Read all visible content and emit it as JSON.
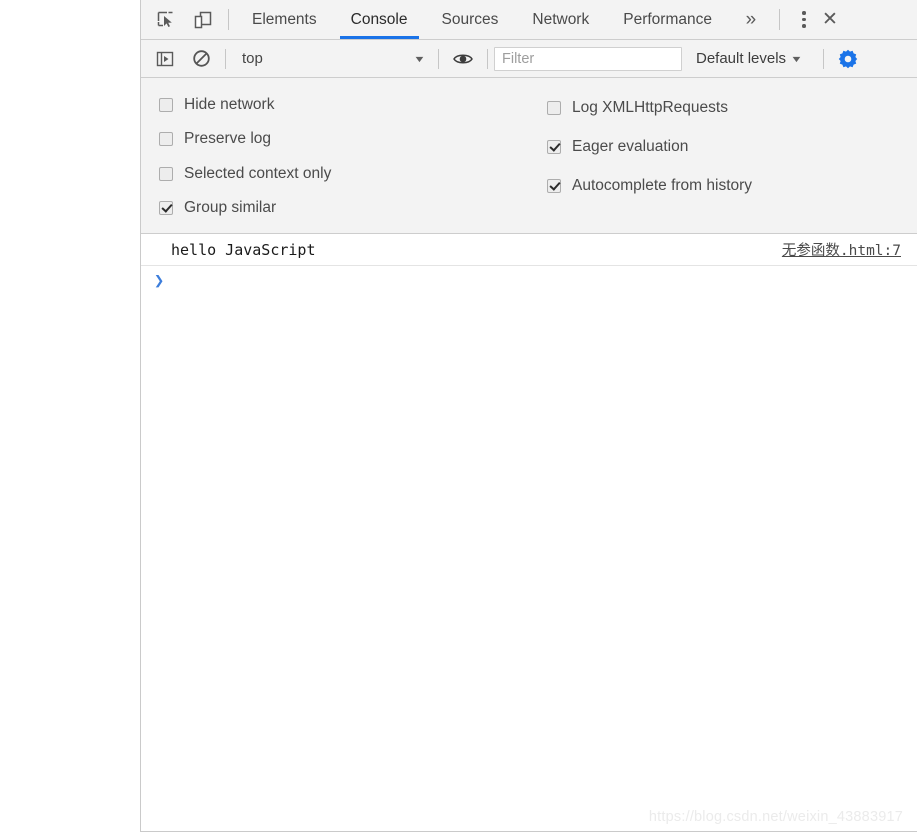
{
  "window": {
    "panel_name": "Chrome DevTools"
  },
  "tabbar": {
    "inspect_icon": "inspect-cursor-icon",
    "device_icon": "device-toolbar-icon",
    "tabs": [
      {
        "label": "Elements",
        "active": false
      },
      {
        "label": "Console",
        "active": true
      },
      {
        "label": "Sources",
        "active": false
      },
      {
        "label": "Network",
        "active": false
      },
      {
        "label": "Performance",
        "active": false
      }
    ],
    "overflow_label": "»",
    "more_options_icon": "kebab-menu-icon",
    "close_label": "✕",
    "active_tab_underline_color": "#1a73e8"
  },
  "filterbar": {
    "sidebar_toggle_icon": "console-sidebar-icon",
    "clear_console_icon": "clear-console-icon",
    "context": {
      "value": "top",
      "caret": "▼"
    },
    "eye_icon": "live-expression-eye-icon",
    "filter": {
      "value": "",
      "placeholder": "Filter"
    },
    "levels": {
      "label": "Default levels",
      "caret": "▼"
    },
    "settings_gear_icon": "settings-gear-icon",
    "settings_gear_color": "#1a73e8"
  },
  "settings": {
    "left_column": [
      {
        "label": "Hide network",
        "checked": false
      },
      {
        "label": "Preserve log",
        "checked": false
      },
      {
        "label": "Selected context only",
        "checked": false
      },
      {
        "label": "Group similar",
        "checked": true
      }
    ],
    "right_column": [
      {
        "label": "Log XMLHttpRequests",
        "checked": false
      },
      {
        "label": "Eager evaluation",
        "checked": true
      },
      {
        "label": "Autocomplete from history",
        "checked": true
      }
    ]
  },
  "console": {
    "messages": [
      {
        "text": "hello JavaScript",
        "source": "无参函数.html:7"
      }
    ],
    "prompt_chevron": "❯",
    "prompt_value": ""
  },
  "watermark": {
    "text": "https://blog.csdn.net/weixin_43883917"
  }
}
